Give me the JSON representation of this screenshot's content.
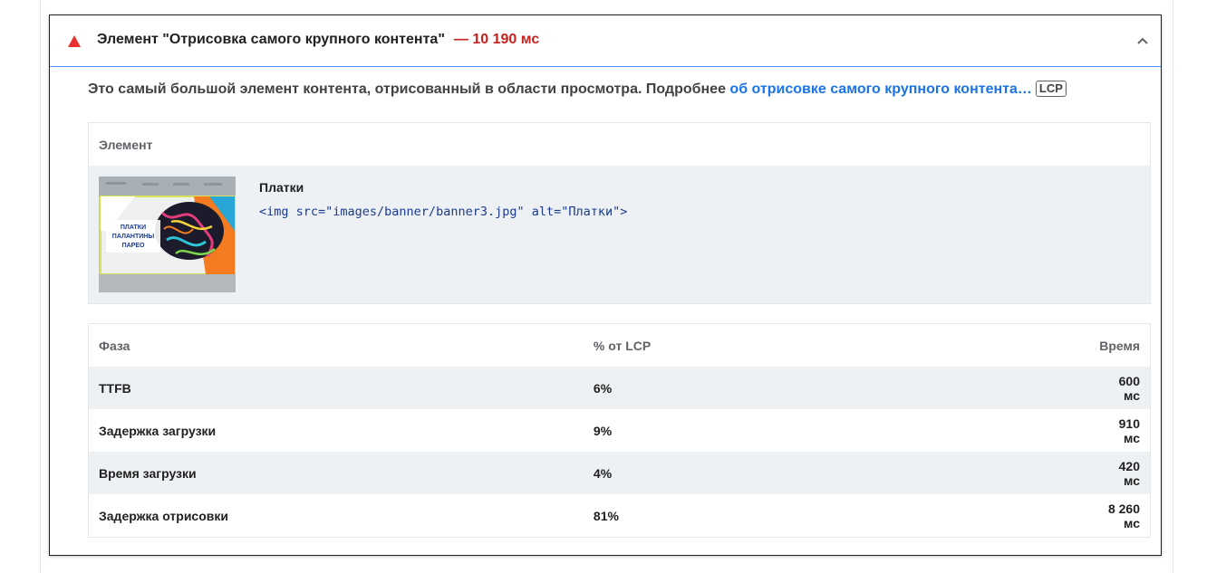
{
  "audit": {
    "title": "Элемент \"Отрисовка самого крупного контента\"",
    "display_value": "— 10 190 мс",
    "status_color": "#c5221f",
    "description_text": "Это самый большой элемент контента, отрисованный в области просмотра. Подробнее ",
    "description_link": "об отрисовке самого крупного контента…",
    "badge": "LCP"
  },
  "element_table": {
    "header": "Элемент",
    "node_label": "Платки",
    "snippet": "<img src=\"images/banner/banner3.jpg\" alt=\"Платки\">",
    "thumbnail_text": [
      "ПЛАТКИ",
      "ПАЛАНТИНЫ",
      "ПАРЕО"
    ]
  },
  "phase_table": {
    "headers": [
      "Фаза",
      "% от LCP",
      "Время"
    ],
    "rows": [
      {
        "phase": "TTFB",
        "percent": "6%",
        "time": "600 мс"
      },
      {
        "phase": "Задержка загрузки",
        "percent": "9%",
        "time": "910 мс"
      },
      {
        "phase": "Время загрузки",
        "percent": "4%",
        "time": "420 мс"
      },
      {
        "phase": "Задержка отрисовки",
        "percent": "81%",
        "time": "8 260 мс"
      }
    ]
  },
  "icons": {
    "status": "warning-triangle-icon",
    "toggle": "chevron-up-icon"
  }
}
